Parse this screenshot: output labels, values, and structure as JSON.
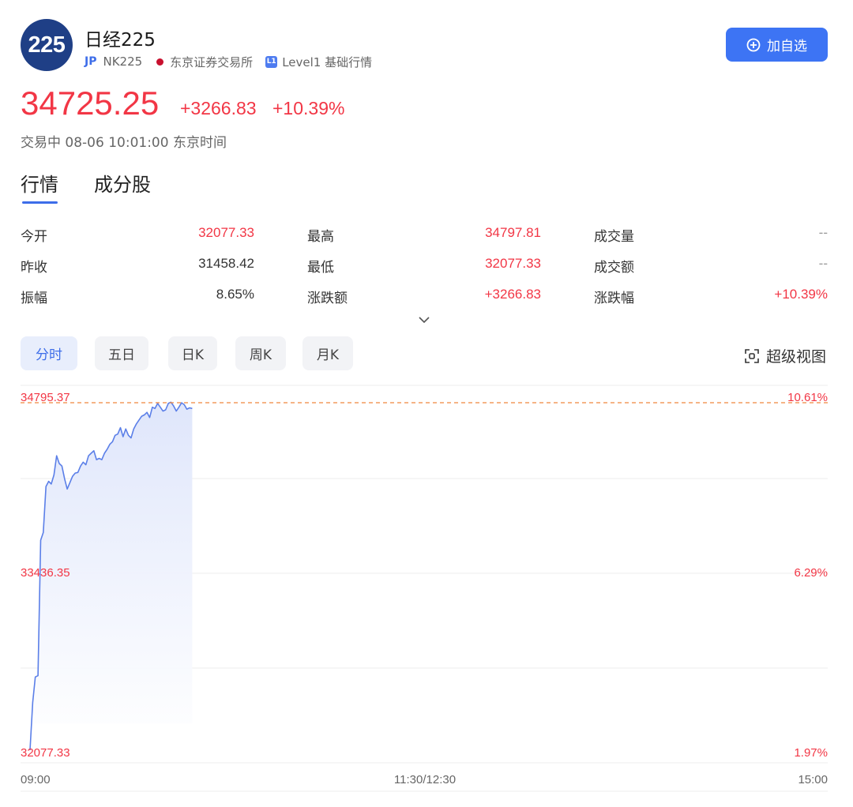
{
  "header": {
    "logo_text": "225",
    "title": "日经225",
    "market_tag": "JP",
    "code": "NK225",
    "exchange": "东京证券交易所",
    "level_badge": "L1",
    "level_text": "Level1 基础行情",
    "add_button": "加自选"
  },
  "quote": {
    "price": "34725.25",
    "change": "+3266.83",
    "change_pct": "+10.39%",
    "status": "交易中 08-06 10:01:00 东京时间"
  },
  "tabs": [
    "行情",
    "成分股"
  ],
  "stats": [
    [
      {
        "label": "今开",
        "value": "32077.33",
        "color": "red"
      },
      {
        "label": "最高",
        "value": "34797.81",
        "color": "red"
      },
      {
        "label": "成交量",
        "value": "--",
        "color": "gray"
      }
    ],
    [
      {
        "label": "昨收",
        "value": "31458.42",
        "color": "dark"
      },
      {
        "label": "最低",
        "value": "32077.33",
        "color": "red"
      },
      {
        "label": "成交额",
        "value": "--",
        "color": "gray"
      }
    ],
    [
      {
        "label": "振幅",
        "value": "8.65%",
        "color": "dark"
      },
      {
        "label": "涨跌额",
        "value": "+3266.83",
        "color": "red"
      },
      {
        "label": "涨跌幅",
        "value": "+10.39%",
        "color": "red"
      }
    ]
  ],
  "period_tabs": [
    "分时",
    "五日",
    "日K",
    "周K",
    "月K"
  ],
  "super_chart": "超级视图",
  "colors": {
    "up": "#f23645",
    "accent": "#3d6de9",
    "line": "#5b7fe8",
    "ref": "#f0883e"
  },
  "chart_data": {
    "type": "line",
    "y_labels_left": [
      "34795.37",
      "33436.35",
      "32077.33"
    ],
    "y_labels_right": [
      "10.61%",
      "6.29%",
      "1.97%"
    ],
    "reference_value": 34795.37,
    "ylim": [
      32077.33,
      34795.37
    ],
    "x_labels": [
      "09:00",
      "11:30/12:30",
      "15:00"
    ],
    "session_minutes": 300,
    "minutes": [
      0,
      1,
      2,
      3,
      4,
      5,
      6,
      7,
      8,
      9,
      10,
      11,
      12,
      13,
      14,
      15,
      16,
      17,
      18,
      19,
      20,
      21,
      22,
      23,
      24,
      25,
      26,
      27,
      28,
      29,
      30,
      31,
      32,
      33,
      34,
      35,
      36,
      37,
      38,
      39,
      40,
      41,
      42,
      43,
      44,
      45,
      46,
      47,
      48,
      49,
      50,
      51,
      52,
      53,
      54,
      55,
      56,
      57,
      58,
      59,
      60,
      61
    ],
    "values": [
      32077.33,
      32450,
      32650,
      32660,
      33720,
      33780,
      34140,
      34180,
      34160,
      34230,
      34380,
      34320,
      34300,
      34200,
      34120,
      34170,
      34220,
      34245,
      34250,
      34300,
      34330,
      34310,
      34380,
      34400,
      34420,
      34350,
      34360,
      34350,
      34400,
      34430,
      34470,
      34490,
      34540,
      34550,
      34600,
      34530,
      34590,
      34540,
      34520,
      34590,
      34630,
      34660,
      34690,
      34700,
      34720,
      34680,
      34760,
      34750,
      34790,
      34760,
      34730,
      34740,
      34790,
      34800,
      34770,
      34730,
      34760,
      34795,
      34780,
      34745,
      34755,
      34750
    ]
  }
}
